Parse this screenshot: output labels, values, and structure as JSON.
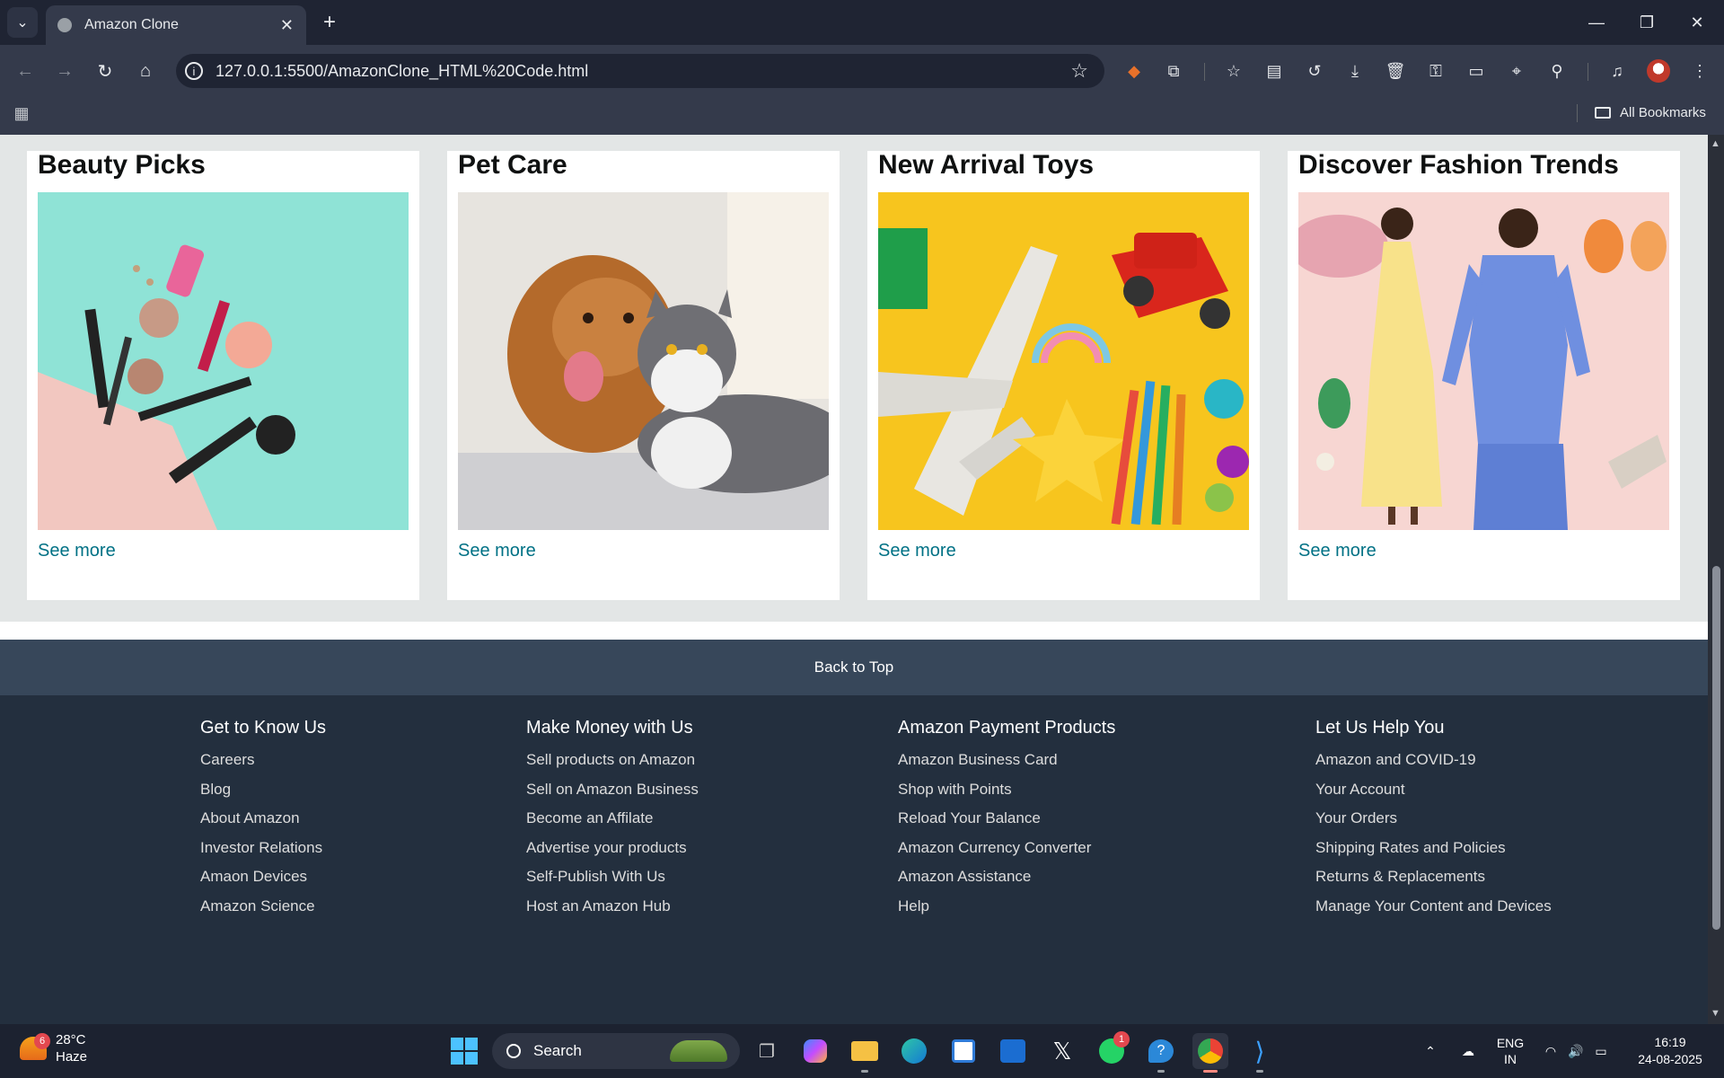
{
  "browser": {
    "tab_title": "Amazon Clone",
    "url": "127.0.0.1:5500/AmazonClone_HTML%20Code.html",
    "all_bookmarks": "All Bookmarks"
  },
  "cards": [
    {
      "title": "Beauty Picks",
      "link": "See more"
    },
    {
      "title": "Pet Care",
      "link": "See more"
    },
    {
      "title": "New Arrival Toys",
      "link": "See more"
    },
    {
      "title": "Discover Fashion Trends",
      "link": "See more"
    }
  ],
  "back_to_top": "Back to Top",
  "footer": {
    "columns": [
      {
        "heading": "Get to Know Us",
        "links": [
          "Careers",
          "Blog",
          "About Amazon",
          "Investor Relations",
          "Amaon Devices",
          "Amazon Science"
        ]
      },
      {
        "heading": "Make Money with Us",
        "links": [
          "Sell products on Amazon",
          "Sell on Amazon Business",
          "Become an Affilate",
          "Advertise your products",
          "Self-Publish With Us",
          "Host an Amazon Hub"
        ]
      },
      {
        "heading": "Amazon Payment Products",
        "links": [
          "Amazon Business Card",
          "Shop with Points",
          "Reload Your Balance",
          "Amazon Currency Converter",
          "Amazon Assistance",
          "Help"
        ]
      },
      {
        "heading": "Let Us Help You",
        "links": [
          "Amazon and COVID-19",
          "Your Account",
          "Your Orders",
          "Shipping Rates and Policies",
          "Returns & Replacements",
          "Manage Your Content and Devices"
        ]
      }
    ]
  },
  "taskbar": {
    "weather_temp": "28°C",
    "weather_desc": "Haze",
    "weather_badge": "6",
    "search_label": "Search",
    "whatsapp_badge": "1",
    "lang_1": "ENG",
    "lang_2": "IN",
    "time": "16:19",
    "date": "24-08-2025"
  },
  "colors": {
    "link": "#007185",
    "footer_bg": "#232f3e",
    "back_to_top_bg": "#37475a"
  }
}
